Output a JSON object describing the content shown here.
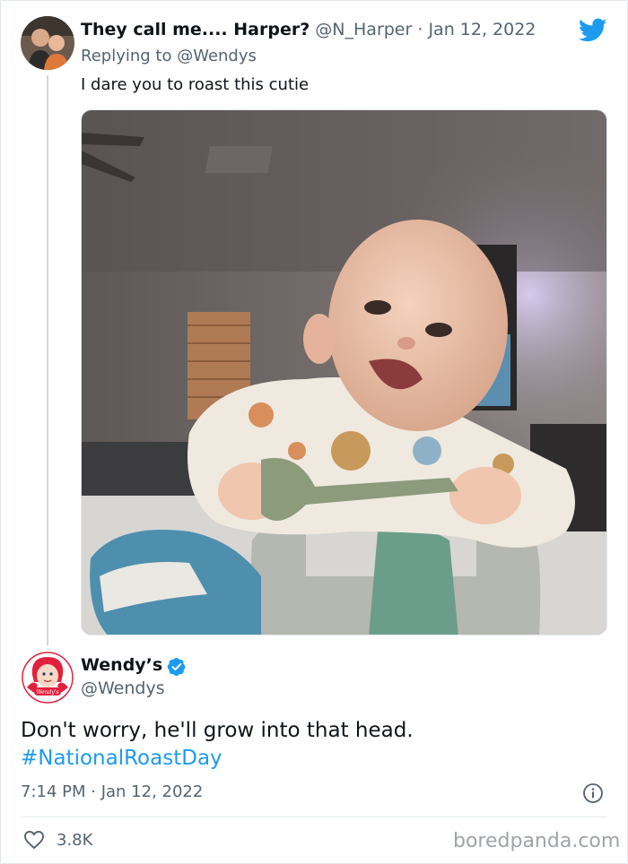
{
  "reply_tweet": {
    "display_name": "They call me.... Harper?",
    "handle": "@N_Harper",
    "separator": " · ",
    "date": "Jan 12, 2022",
    "replying_prefix": "Replying to ",
    "replying_to": "@Wendys",
    "text": "I dare you to roast this cutie",
    "avatar_icon": "user-avatar-icon",
    "media_icon": "baby-photo"
  },
  "main_tweet": {
    "display_name": "Wendy’s",
    "handle": "@Wendys",
    "verified": true,
    "text": "Don't worry, he'll grow into that head.",
    "hashtag": "#NationalRoastDay",
    "timestamp": "7:14 PM · Jan 12, 2022",
    "likes": "3.8K"
  },
  "brand": {
    "twitter_blue": "#1d9bf0",
    "wendys_red": "#e2203d"
  },
  "watermark": "boredpanda.com"
}
